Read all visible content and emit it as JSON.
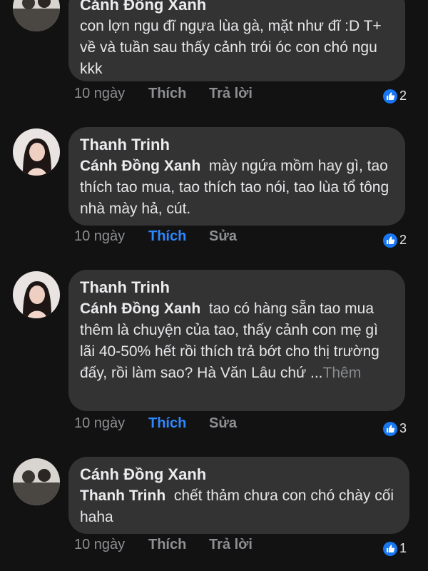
{
  "comments": [
    {
      "author": "Cánh Đồng Xanh",
      "text": "con lợn ngu đĩ ngựa lùa gà, mặt như đĩ :D  T+ về và tuần sau thấy cảnh trói óc con chó ngu kkk",
      "time": "10 ngày",
      "like_label": "Thích",
      "action_label": "Trả lời",
      "reactions": "2"
    },
    {
      "author": "Thanh Trinh",
      "mention": "Cánh Đồng Xanh",
      "text": "mày ngứa mồm hay gì, tao thích tao mua, tao thích tao nói, tao lùa tổ tông nhà mày hả, cút.",
      "time": "10 ngày",
      "like_label": "Thích",
      "action_label": "Sửa",
      "reactions": "2"
    },
    {
      "author": "Thanh Trinh",
      "mention": "Cánh Đồng Xanh",
      "text": "tao có hàng sẵn tao mua thêm là chuyện của tao, thấy cảnh con mẹ gì lãi 40-50% hết rồi thích trả bớt cho thị trường đấy, rồi làm sao? Hà Văn Lâu chứ ...",
      "more_label": "Thêm",
      "time": "10 ngày",
      "like_label": "Thích",
      "action_label": "Sửa",
      "reactions": "3"
    },
    {
      "author": "Cánh Đồng Xanh",
      "mention": "Thanh Trinh",
      "text": "chết thảm chưa con chó chày cối haha",
      "time": "10 ngày",
      "like_label": "Thích",
      "action_label": "Trả lời",
      "reactions": "1"
    }
  ],
  "colors": {
    "background": "#121212",
    "bubble": "#333334",
    "like_active": "#2d88ff",
    "reaction_blue": "#1877f2"
  },
  "icons": {
    "reaction": "like-thumb-icon"
  }
}
